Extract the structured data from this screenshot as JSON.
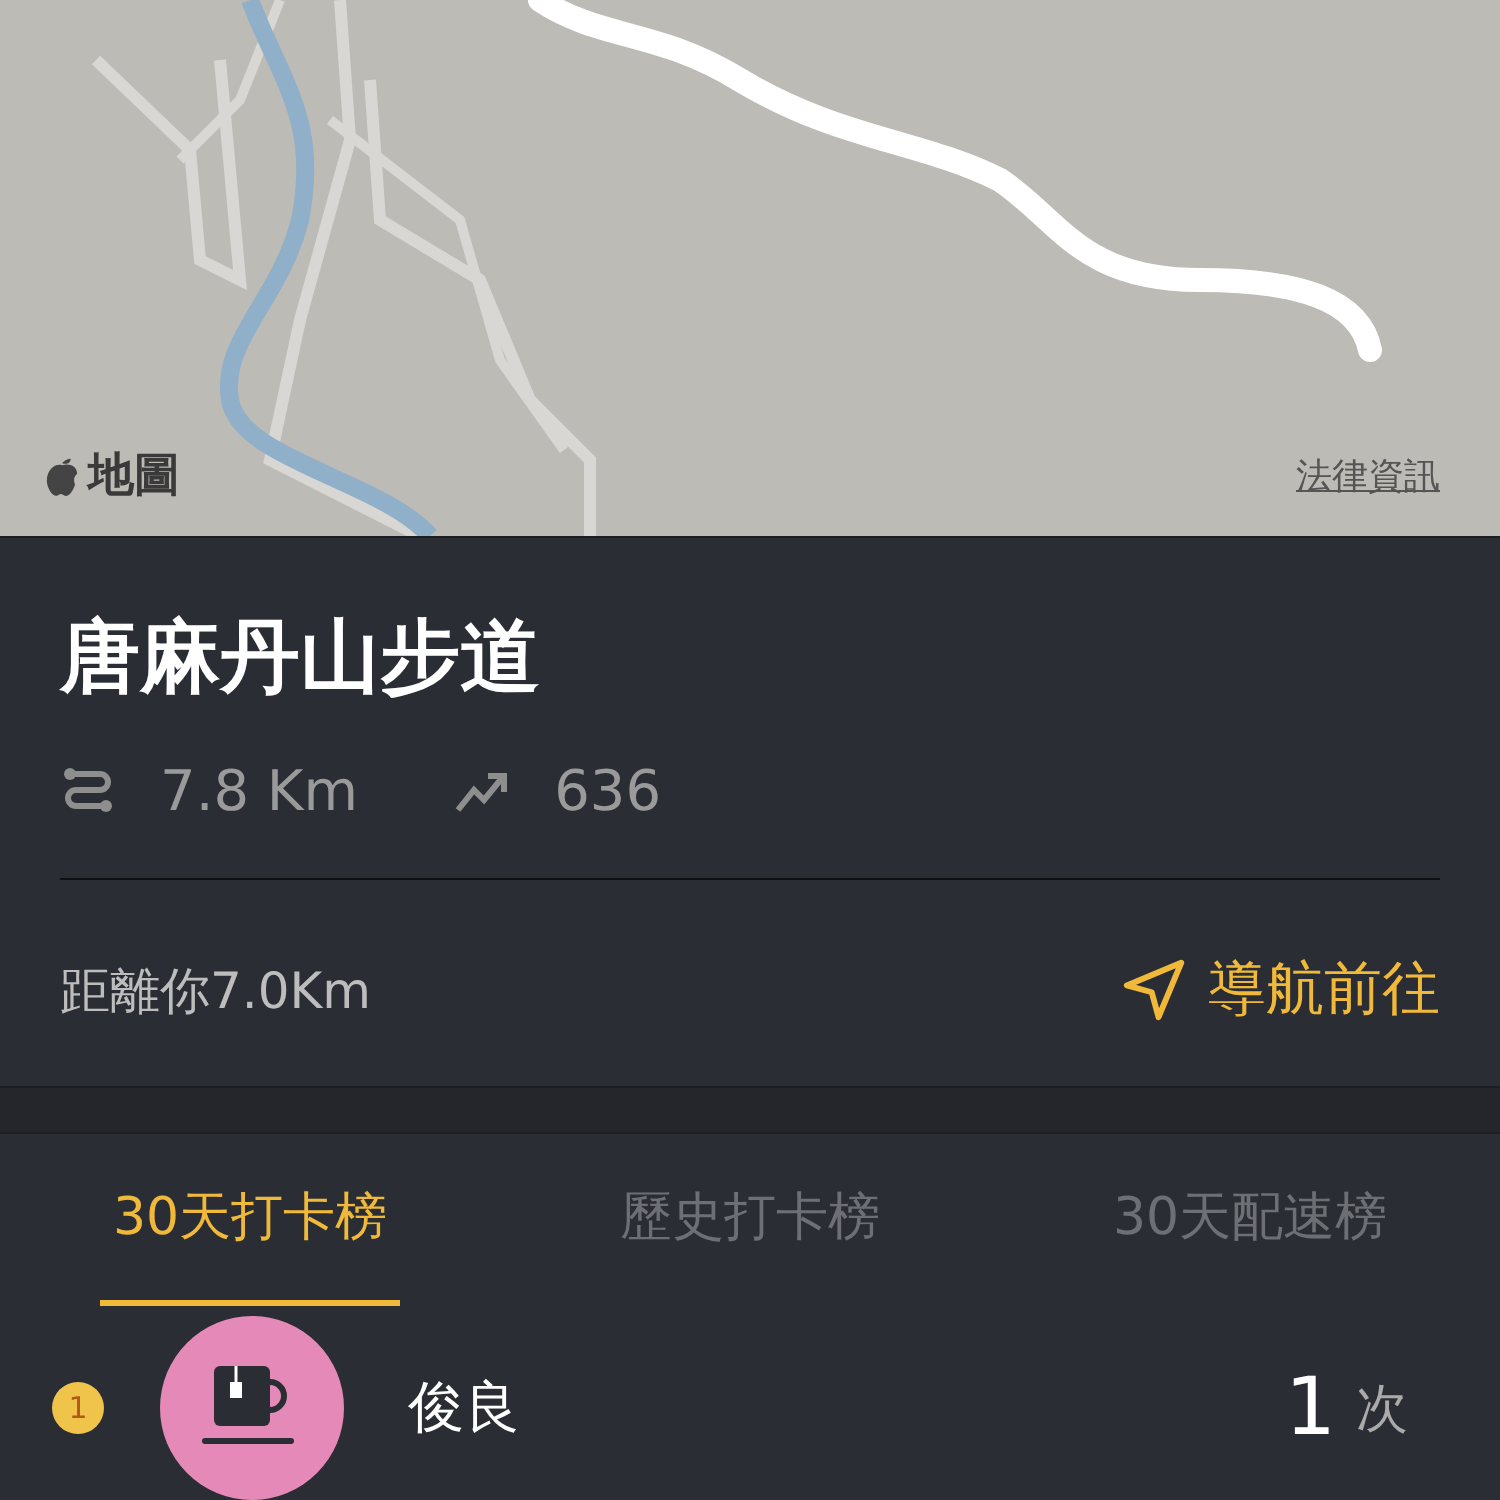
{
  "map": {
    "brand": "地圖",
    "legal_link": "法律資訊"
  },
  "trail": {
    "name": "唐麻丹山步道",
    "distance": "7.8 Km",
    "elevation": "636",
    "distance_from_you": "距離你7.0Km",
    "navigate_button": "導航前往"
  },
  "tabs": [
    {
      "label": "30天打卡榜",
      "selected": true
    },
    {
      "label": "歷史打卡榜",
      "selected": false
    },
    {
      "label": "30天配速榜",
      "selected": false
    }
  ],
  "leaderboard": [
    {
      "rank": "1",
      "name": "俊良",
      "count": "1",
      "unit": "次"
    }
  ]
}
